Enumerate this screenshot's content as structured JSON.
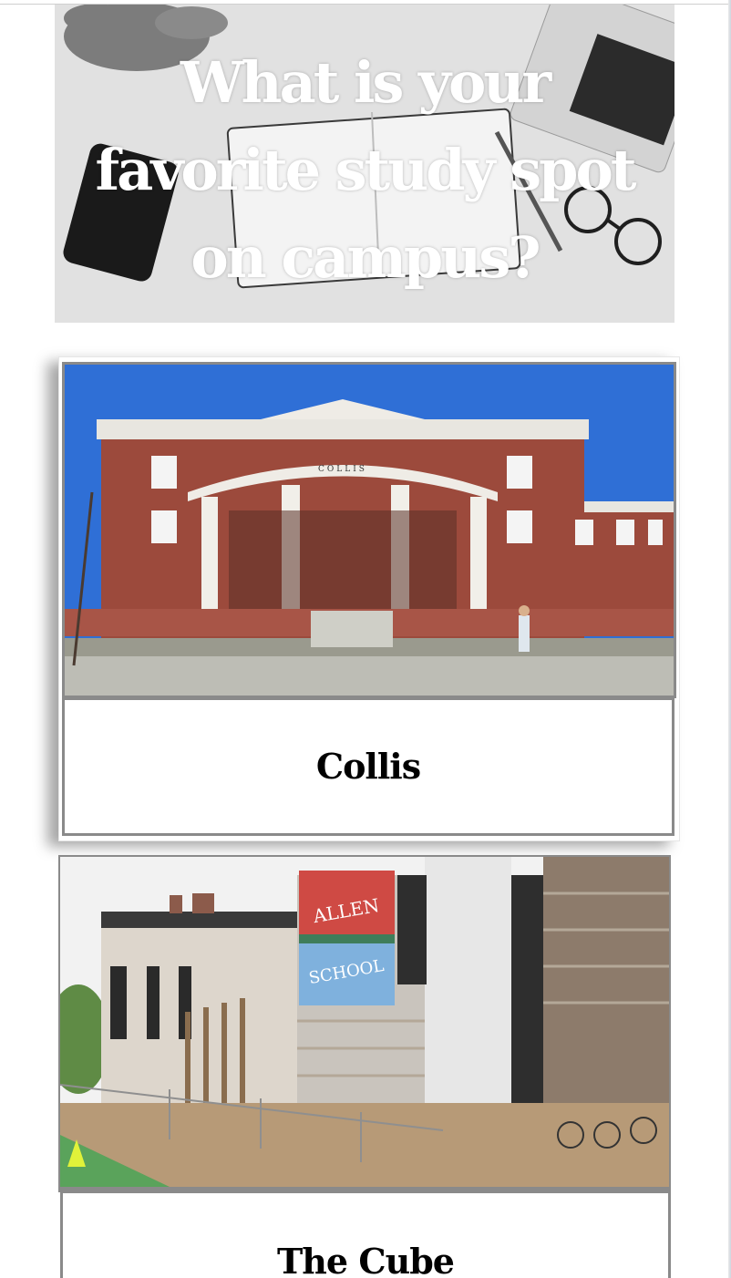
{
  "hero": {
    "title": "What is your favorite study spot on campus?"
  },
  "spots": [
    {
      "name": "Collis",
      "building_sign": "COLLIS"
    },
    {
      "name": "The Cube",
      "banner_top": "ALLEN",
      "banner_bottom": "SCHOOL"
    }
  ],
  "colors": {
    "sky": "#2f6fd6",
    "brick": "#9c4a3c",
    "banner_red": "#cf4a44",
    "banner_blue": "#7fb1dd",
    "caption_border": "#8a8a8a"
  }
}
